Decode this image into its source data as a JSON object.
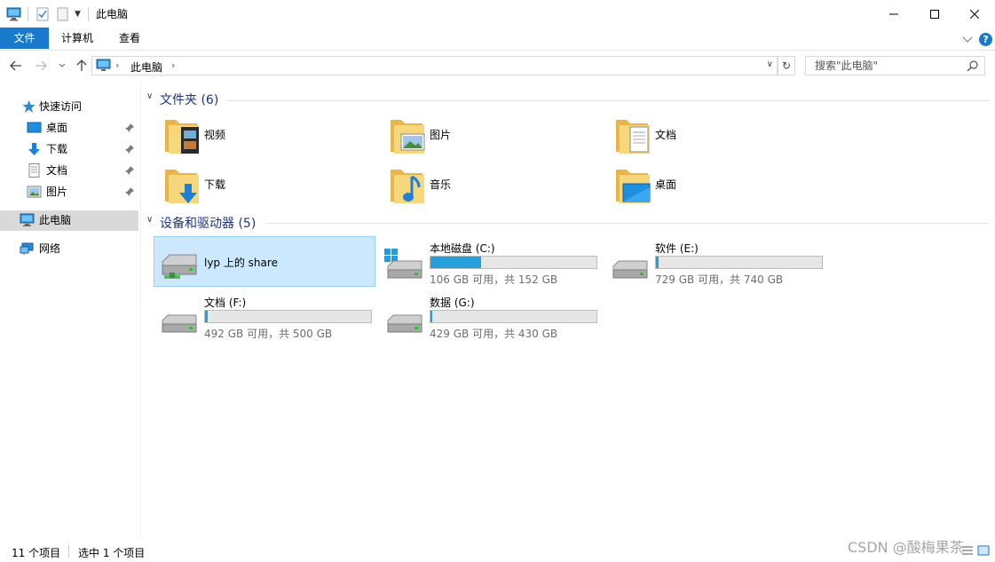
{
  "window": {
    "title": "此电脑"
  },
  "ribbon": {
    "tabs": [
      "文件",
      "计算机",
      "查看"
    ],
    "help": "?"
  },
  "address": {
    "breadcrumb": "此电脑",
    "search_placeholder": "搜索\"此电脑\""
  },
  "sidebar": {
    "quick_access": "快速访问",
    "pinned": [
      {
        "label": "桌面",
        "icon": "desktop-icon"
      },
      {
        "label": "下载",
        "icon": "download-icon"
      },
      {
        "label": "文档",
        "icon": "document-icon"
      },
      {
        "label": "图片",
        "icon": "picture-icon"
      }
    ],
    "this_pc": "此电脑",
    "network": "网络"
  },
  "folders": {
    "header": "文件夹 (6)",
    "items": [
      {
        "label": "视频",
        "icon": "video-folder-icon"
      },
      {
        "label": "图片",
        "icon": "pictures-folder-icon"
      },
      {
        "label": "文档",
        "icon": "documents-folder-icon"
      },
      {
        "label": "下载",
        "icon": "downloads-folder-icon"
      },
      {
        "label": "音乐",
        "icon": "music-folder-icon"
      },
      {
        "label": "桌面",
        "icon": "desktop-folder-icon"
      }
    ]
  },
  "drives": {
    "header": "设备和驱动器 (5)",
    "items": [
      {
        "name": "lyp 上的 share",
        "icon": "network-share-icon",
        "selected": true
      },
      {
        "name": "本地磁盘 (C:)",
        "info": "106 GB 可用，共 152 GB",
        "used_fraction": 0.303,
        "icon": "windows-drive-icon"
      },
      {
        "name": "软件 (E:)",
        "info": "729 GB 可用，共 740 GB",
        "used_fraction": 0.015,
        "icon": "drive-icon"
      },
      {
        "name": "文档 (F:)",
        "info": "492 GB 可用，共 500 GB",
        "used_fraction": 0.016,
        "icon": "drive-icon"
      },
      {
        "name": "数据 (G:)",
        "info": "429 GB 可用，共 430 GB",
        "used_fraction": 0.002,
        "icon": "drive-icon"
      }
    ]
  },
  "status": {
    "count": "11 个项目",
    "selected": "选中 1 个项目"
  },
  "watermark": "CSDN @酸梅果茶",
  "colors": {
    "accent": "#1979ca",
    "bar_fill": "#26a0da",
    "selection": "#cce8ff",
    "header": "#1e3287"
  }
}
